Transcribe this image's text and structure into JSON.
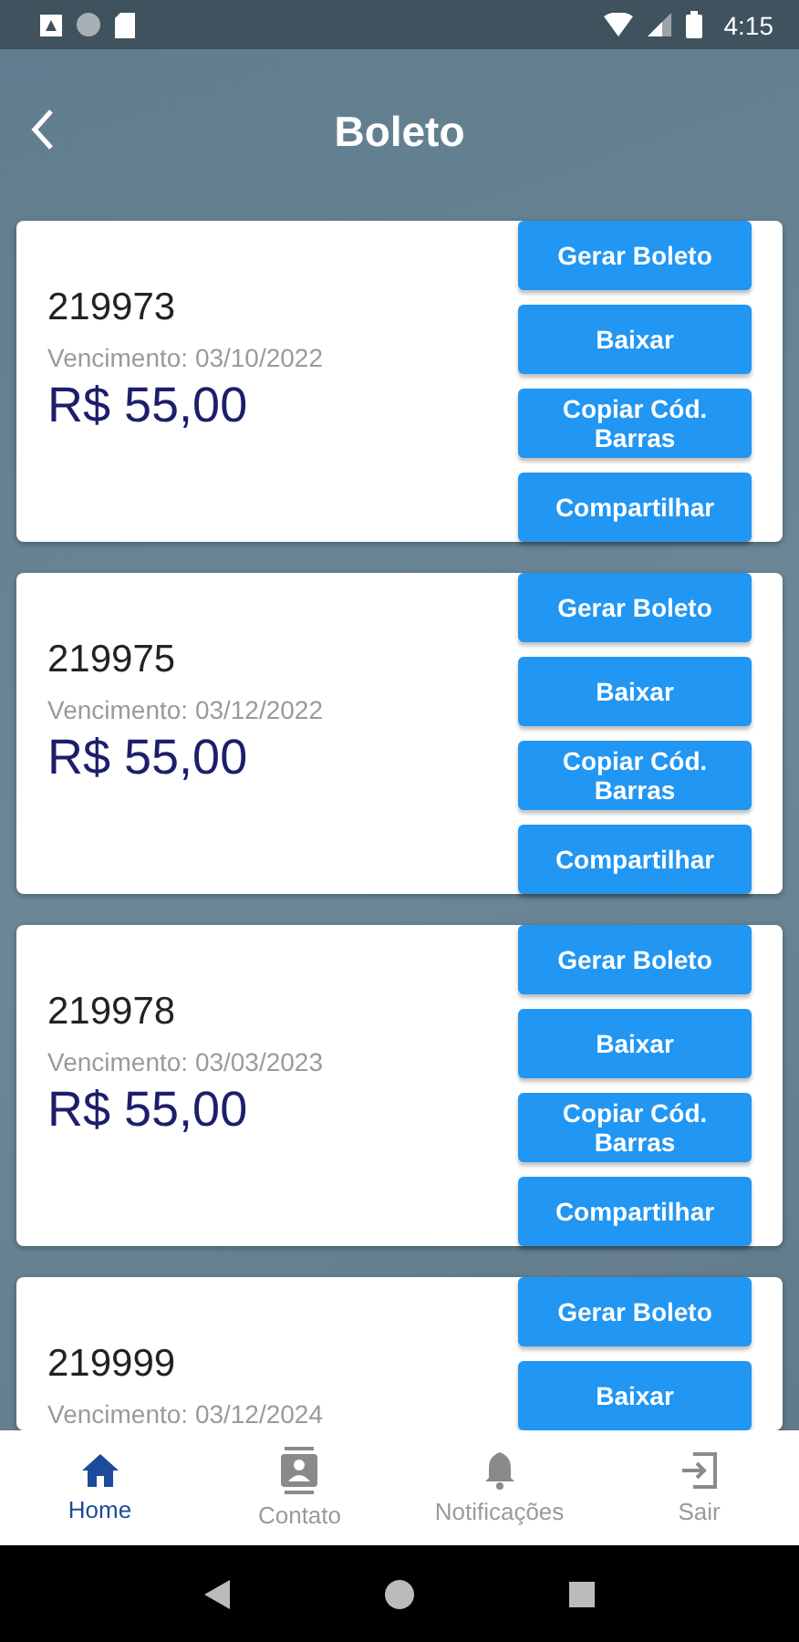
{
  "status_bar": {
    "time": "4:15"
  },
  "header": {
    "title": "Boleto"
  },
  "boletos": [
    {
      "number": "219973",
      "due": "Vencimento: 03/10/2022",
      "amount": "R$ 55,00",
      "buttons": [
        "Gerar Boleto",
        "Baixar",
        "Copiar Cód. Barras",
        "Compartilhar"
      ]
    },
    {
      "number": "219975",
      "due": "Vencimento: 03/12/2022",
      "amount": "R$ 55,00",
      "buttons": [
        "Gerar Boleto",
        "Baixar",
        "Copiar Cód. Barras",
        "Compartilhar"
      ]
    },
    {
      "number": "219978",
      "due": "Vencimento: 03/03/2023",
      "amount": "R$ 55,00",
      "buttons": [
        "Gerar Boleto",
        "Baixar",
        "Copiar Cód. Barras",
        "Compartilhar"
      ]
    },
    {
      "number": "219999",
      "due": "Vencimento: 03/12/2024",
      "buttons": [
        "Gerar Boleto",
        "Baixar"
      ]
    }
  ],
  "bottom_nav": [
    {
      "kind": "home",
      "label": "Home",
      "selected": true
    },
    {
      "kind": "contact",
      "label": "Contato",
      "selected": false
    },
    {
      "kind": "bell",
      "label": "Notificações",
      "selected": false
    },
    {
      "kind": "exit",
      "label": "Sair",
      "selected": false
    }
  ]
}
